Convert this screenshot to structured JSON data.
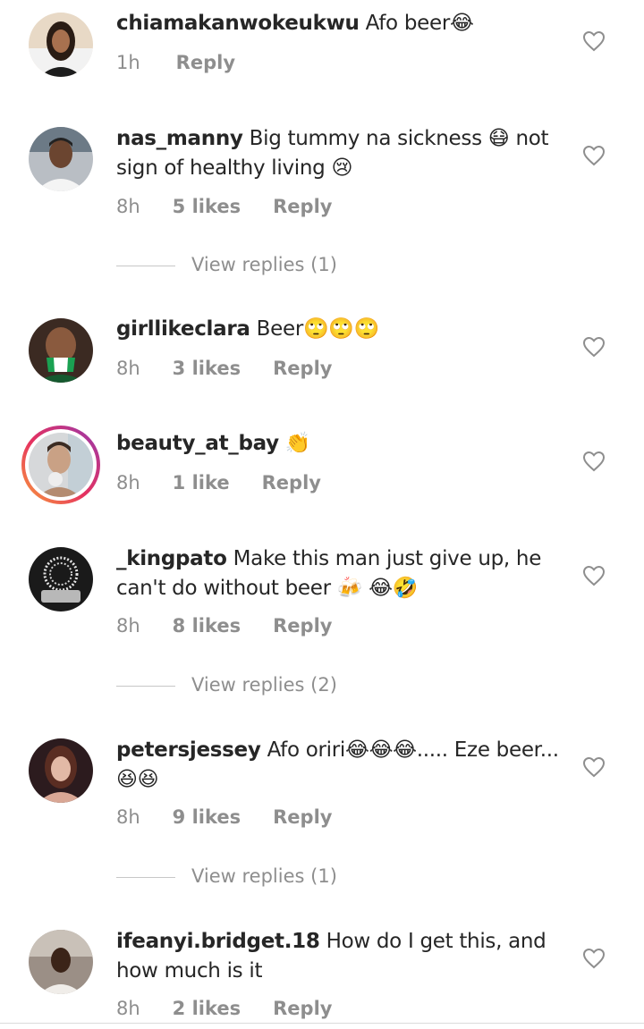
{
  "comments": [
    {
      "username": "chiamakanwokeukwu",
      "text": "Afo beer😂",
      "time": "1h",
      "likes": "",
      "reply": "Reply",
      "view_replies": ""
    },
    {
      "username": "nas_manny",
      "text": "Big tummy na sickness 😷 not sign of healthy living 😢",
      "time": "8h",
      "likes": "5 likes",
      "reply": "Reply",
      "view_replies": "View replies (1)"
    },
    {
      "username": "girllikeclara",
      "text": "Beer🙄🙄🙄",
      "time": "8h",
      "likes": "3 likes",
      "reply": "Reply",
      "view_replies": ""
    },
    {
      "username": "beauty_at_bay",
      "text": "👏",
      "time": "8h",
      "likes": "1 like",
      "reply": "Reply",
      "view_replies": ""
    },
    {
      "username": "_kingpato",
      "text": "Make this man just give up, he can't do without beer 🍻 😂🤣",
      "time": "8h",
      "likes": "8 likes",
      "reply": "Reply",
      "view_replies": "View replies (2)"
    },
    {
      "username": "petersjessey",
      "text": "Afo oriri😂😂😂..... Eze beer... 😆😆",
      "time": "8h",
      "likes": "9 likes",
      "reply": "Reply",
      "view_replies": "View replies (1)"
    },
    {
      "username": "ifeanyi.bridget.18",
      "text": "How do I get this, and how much is it",
      "time": "8h",
      "likes": "2 likes",
      "reply": "Reply",
      "view_replies": ""
    }
  ],
  "icons": {
    "like": "heart-outline-icon"
  },
  "colors": {
    "text": "#262626",
    "muted": "#8e8e8e",
    "story_ring_start": "#f9a13a",
    "story_ring_end": "#8a3ab9"
  }
}
